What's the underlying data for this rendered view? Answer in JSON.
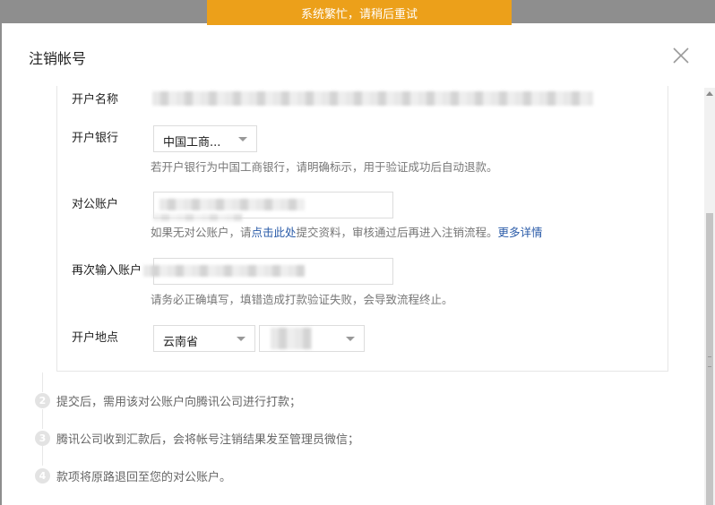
{
  "toast": {
    "message": "系统繁忙，请稍后重试"
  },
  "dialog": {
    "title": "注销帐号"
  },
  "form": {
    "account_name": {
      "label": "开户名称"
    },
    "bank": {
      "label": "开户银行",
      "selected": "中国工商...",
      "hint": "若开户银行为中国工商银行，请明确标示，用于验证成功后自动退款。"
    },
    "corp_account": {
      "label": "对公账户",
      "hint_prefix": "如果无对公账户，请",
      "hint_link": "点击此处",
      "hint_suffix": "提交资料，审核通过后再进入注销流程。",
      "more_link": "更多详情"
    },
    "confirm_account": {
      "label": "再次输入账户",
      "hint": "请务必正确填写，填错造成打款验证失败，会导致流程终止。"
    },
    "location": {
      "label": "开户地点",
      "province": "云南省",
      "city": ""
    }
  },
  "steps": [
    {
      "number": "2",
      "text": "提交后，需用该对公账户向腾讯公司进行打款；"
    },
    {
      "number": "3",
      "text": "腾讯公司收到汇款后，会将帐号注销结果发至管理员微信；"
    },
    {
      "number": "4",
      "text": "款项将原路退回至您的对公账户。"
    }
  ],
  "colors": {
    "toast_bg": "#eca01a",
    "link": "#2a5ba8"
  }
}
